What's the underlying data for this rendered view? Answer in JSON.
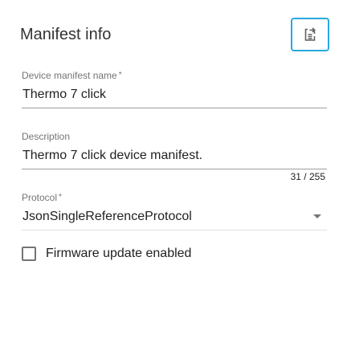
{
  "header": {
    "title": "Manifest info",
    "action_icon": "sync-document-icon",
    "accent_color": "#29a8e0"
  },
  "form": {
    "name": {
      "label": "Device manifest name",
      "required_mark": "*",
      "value": "Thermo 7 click"
    },
    "description": {
      "label": "Description",
      "value": "Thermo 7 click device manifest.",
      "counter": "31 / 255"
    },
    "protocol": {
      "label": "Protocol",
      "required_mark": "*",
      "value": "JsonSingleReferenceProtocol",
      "icon": "dropdown-arrow-icon"
    },
    "firmware": {
      "label": "Firmware update enabled",
      "checked": false
    }
  }
}
